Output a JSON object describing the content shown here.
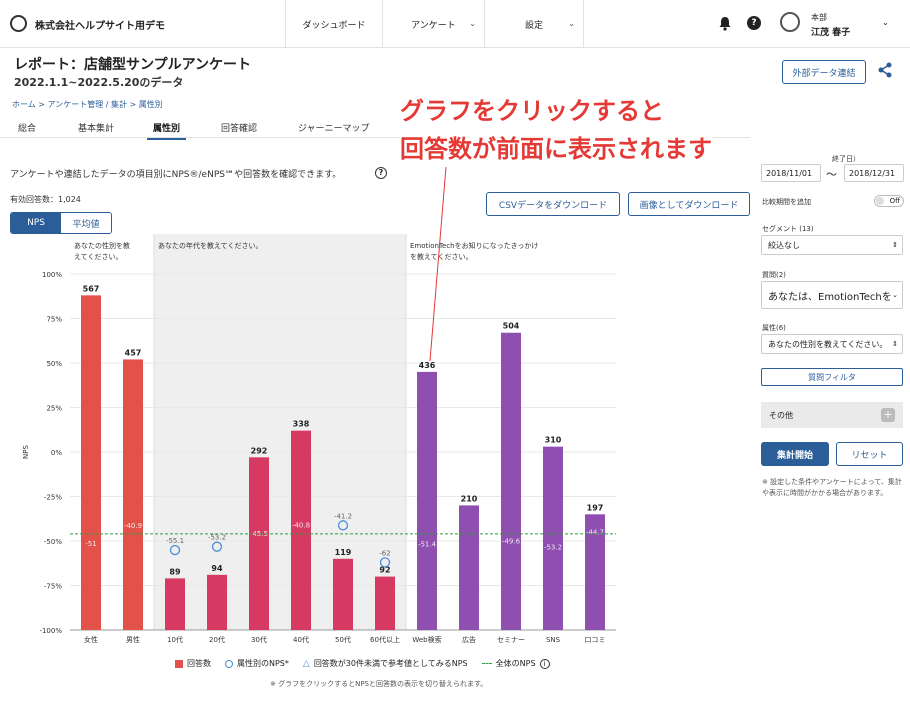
{
  "header": {
    "company": "株式会社ヘルプサイト用デモ",
    "nav": [
      "ダッシュボード",
      "アンケート",
      "設定"
    ],
    "user_line1": "本部",
    "user_line2": "江茂 春子"
  },
  "page": {
    "title": "レポート：店舗型サンプルアンケート",
    "subtitle": "2022.1.1~2022.5.20のデータ",
    "external_button": "外部データ連結",
    "breadcrumb": "ホーム > アンケート管理 / 集計 > 属性別",
    "tabs": [
      "総合",
      "基本集計",
      "属性別",
      "回答確認",
      "ジャーニーマップ"
    ],
    "active_tab": "属性別",
    "description": "アンケートや連結したデータの項目別にNPS®/eNPS℠や回答数を確認できます。",
    "help": "?",
    "response_count": "有効回答数：1,024",
    "csv_button": "CSVデータをダウンロード",
    "image_button": "画像としてダウンロード",
    "toggle": [
      "NPS",
      "平均値"
    ]
  },
  "annotation": {
    "line1": "グラフをクリックすると",
    "line2": "回答数が前面に表示されます"
  },
  "right_panel": {
    "period_label": "終了日）",
    "start_date": "2018/11/01",
    "tilde": "〜",
    "end_date": "2018/12/31",
    "compare_label": "比較期間を追加",
    "compare_toggle": "Off",
    "segment_label": "セグメント (13)",
    "segment_value": "絞込なし",
    "question_label": "質問(2)",
    "question_value": "あなたは、EmotionTechを",
    "attribute_label": "属性(6)",
    "attribute_value": "あなたの性別を教えてください。",
    "filter_button": "質問フィルタ",
    "other_label": "その他",
    "aggregate_button": "集計開始",
    "reset_button": "リセット",
    "note": "※ 設定した条件やアンケートによって、集計や表示に時間がかかる場合があります。"
  },
  "chart_data": {
    "type": "bar",
    "ylabel": "NPS",
    "ylim": [
      -100,
      100
    ],
    "yticks": [
      "100%",
      "75%",
      "50%",
      "25%",
      "0%",
      "-25%",
      "-50%",
      "-75%",
      "-100%"
    ],
    "groups": [
      {
        "label": "あなたの性別を教えてください。",
        "categories": [
          "女性",
          "男性"
        ]
      },
      {
        "label": "あなたの年代を教えてください。",
        "categories": [
          "10代",
          "20代",
          "30代",
          "40代",
          "50代",
          "60代以上"
        ]
      },
      {
        "label": "EmotionTechをお知りになったきっかけを教えてください。",
        "categories": [
          "Web検索",
          "広告",
          "セミナー",
          "SNS",
          "口コミ"
        ]
      }
    ],
    "categories": [
      "女性",
      "男性",
      "10代",
      "20代",
      "30代",
      "40代",
      "50代",
      "60代以上",
      "Web検索",
      "広告",
      "セミナー",
      "SNS",
      "口コミ"
    ],
    "series": [
      {
        "name": "回答数",
        "values": [
          567,
          457,
          89,
          94,
          292,
          338,
          119,
          92,
          436,
          210,
          504,
          310,
          197
        ]
      },
      {
        "name": "属性別のNPS*",
        "values": [
          -51,
          -40.9,
          -55.1,
          -53.2,
          -45.5,
          -40.8,
          -41.2,
          -62,
          -51.4,
          null,
          -49.6,
          -53.2,
          -44.7
        ]
      }
    ],
    "bar_heights_percent": [
      88,
      52,
      -71,
      -69,
      -3,
      12,
      -60,
      -70,
      45,
      -30,
      67,
      3,
      -35
    ],
    "colors": [
      "#e3524a",
      "#e3524a",
      "#d63a62",
      "#d63a62",
      "#d63a62",
      "#d63a62",
      "#d63a62",
      "#d63a62",
      "#8e4fb0",
      "#8e4fb0",
      "#8e4fb0",
      "#8e4fb0",
      "#8e4fb0"
    ],
    "overall_nps": -46,
    "legend": [
      "回答数",
      "属性別のNPS*",
      "回答数が30件未満で参考値としてみるNPS",
      "全体のNPS"
    ],
    "note": "※ グラフをクリックするとNPSと回答数の表示を切り替えられます。"
  }
}
